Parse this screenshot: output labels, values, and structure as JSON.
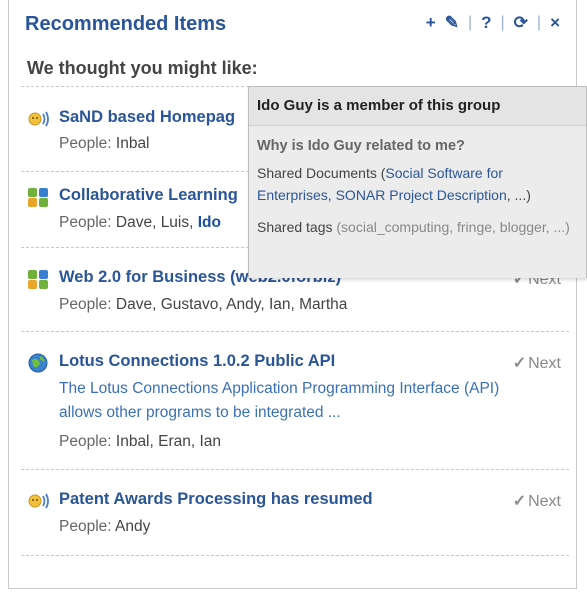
{
  "header": {
    "title": "Recommended Items",
    "subheading": "We thought you might like:",
    "toolbar": {
      "add": "+",
      "edit": "✎",
      "help": "?",
      "refresh": "⟳",
      "close": "×"
    }
  },
  "items": [
    {
      "icon": "people-speech-icon",
      "title": "SaND based Homepag",
      "people_label": "People:",
      "people": "Inbal",
      "highlight": "",
      "next": ""
    },
    {
      "icon": "community-icon",
      "title": "Collaborative Learning",
      "people_label": "People:",
      "people": "Dave, Luis,",
      "highlight": "Ido",
      "next": ""
    },
    {
      "icon": "community-icon",
      "title": "Web 2.0 for Business (web2.0forbiz)",
      "people_label": "People:",
      "people": "Dave, Gustavo, Andy, Ian, Martha",
      "highlight": "",
      "next": "Next"
    },
    {
      "icon": "globe-icon",
      "title": "Lotus Connections 1.0.2 Public API",
      "description": "The Lotus Connections Application Programming Interface (API) allows other programs to be integrated ...",
      "people_label": "People:",
      "people": "Inbal, Eran, Ian",
      "highlight": "",
      "next": "Next"
    },
    {
      "icon": "people-speech-icon",
      "title": "Patent Awards Processing has resumed",
      "people_label": "People:",
      "people": "Andy",
      "highlight": "",
      "next": "Next"
    }
  ],
  "tooltip": {
    "title": "Ido Guy is a member of this group",
    "question": "Why is Ido Guy related to me?",
    "shared_docs_label": "Shared Documents (",
    "shared_docs_links": "Social Software for Enterprises, SONAR Project Description",
    "shared_docs_tail": ", ...)",
    "shared_tags_label": "Shared tags",
    "shared_tags": "(social_computing, fringe, blogger, ...)"
  },
  "colors": {
    "accent": "#2a5598",
    "link": "#3a70b8",
    "tooltip_bg": "#e4e4e4"
  }
}
